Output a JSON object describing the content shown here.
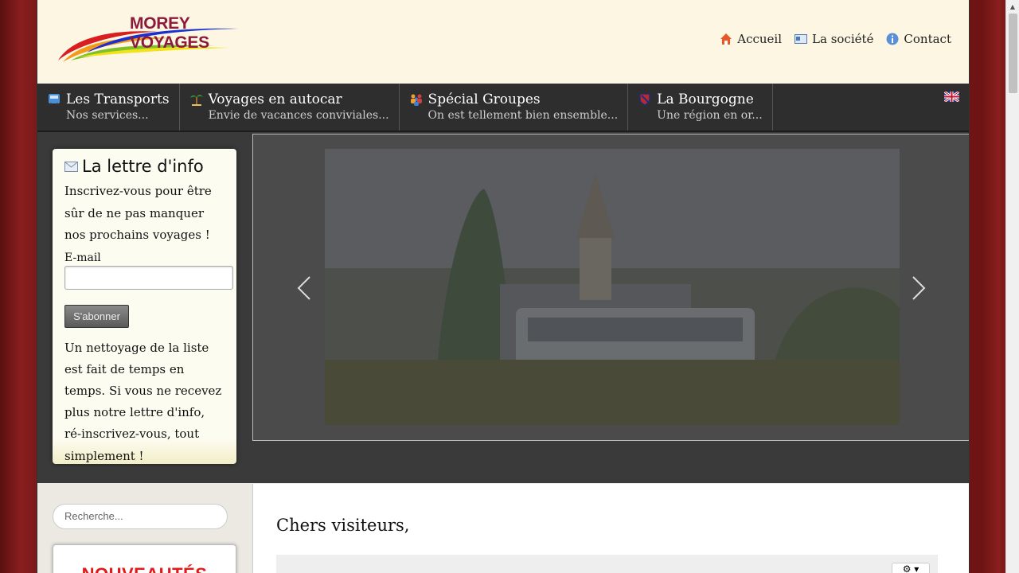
{
  "header": {
    "logo_text": "MOREY VOYAGES",
    "topnav": [
      {
        "label": "Accueil",
        "icon": "home-icon"
      },
      {
        "label": "La société",
        "icon": "id-card-icon"
      },
      {
        "label": "Contact",
        "icon": "info-icon"
      }
    ]
  },
  "mainnav": [
    {
      "title": "Les Transports",
      "sub": "Nos services...",
      "icon": "bus-icon"
    },
    {
      "title": "Voyages en autocar",
      "sub": "Envie de vacances conviviales...",
      "icon": "palm-tree-icon"
    },
    {
      "title": "Spécial Groupes",
      "sub": "On est tellement bien ensemble...",
      "icon": "group-icon"
    },
    {
      "title": "La Bourgogne",
      "sub": "Une région en or...",
      "icon": "shield-icon"
    }
  ],
  "newsletter": {
    "title": "La lettre d'info",
    "intro": "Inscrivez-vous pour être sûr de ne pas manquer nos prochains voyages !",
    "email_label": "E-mail",
    "email_value": "",
    "subscribe_label": "S'abonner",
    "note": "Un nettoyage de la liste est fait de temps en temps. Si vous ne recevez plus notre lettre d'info, ré-inscrivez-vous, tout simplement !"
  },
  "search": {
    "placeholder": "Recherche..."
  },
  "news": {
    "title": "NOUVEAUTÉS"
  },
  "content": {
    "heading": "Chers visiteurs,"
  },
  "colors": {
    "brand": "#8c1a3a",
    "nav_bg": "#2e2e2e",
    "header_bg": "#fdf6e3",
    "news_red": "#e01b1b"
  }
}
